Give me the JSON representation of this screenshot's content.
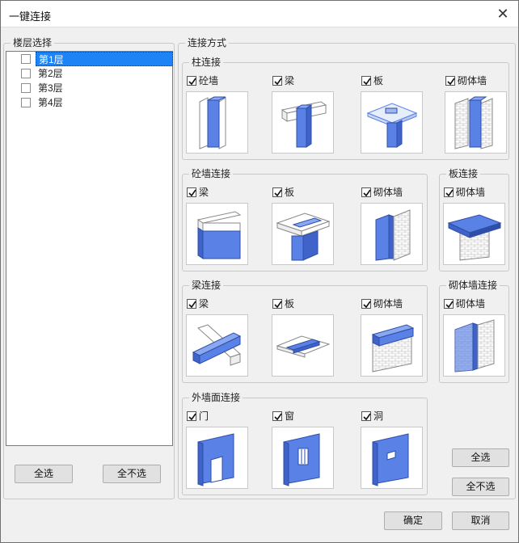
{
  "window": {
    "title": "一键连接",
    "close_glyph": "✕"
  },
  "floor_panel": {
    "label": "楼层选择",
    "floors": [
      {
        "label": "第1层",
        "checked": false,
        "selected": true
      },
      {
        "label": "第2层",
        "checked": false,
        "selected": false
      },
      {
        "label": "第3层",
        "checked": false,
        "selected": false
      },
      {
        "label": "第4层",
        "checked": false,
        "selected": false
      }
    ],
    "select_all_label": "全选",
    "select_none_label": "全不选"
  },
  "connect": {
    "label": "连接方式",
    "column": {
      "label": "柱连接",
      "options": [
        {
          "label": "砼墙",
          "checked": true,
          "icon": "column-concrete-wall-icon"
        },
        {
          "label": "梁",
          "checked": true,
          "icon": "column-beam-icon"
        },
        {
          "label": "板",
          "checked": true,
          "icon": "column-slab-icon"
        },
        {
          "label": "砌体墙",
          "checked": true,
          "icon": "column-masonry-wall-icon"
        }
      ]
    },
    "concrete_wall": {
      "label": "砼墙连接",
      "options": [
        {
          "label": "梁",
          "checked": true,
          "icon": "wall-beam-icon"
        },
        {
          "label": "板",
          "checked": true,
          "icon": "wall-slab-icon"
        },
        {
          "label": "砌体墙",
          "checked": true,
          "icon": "wall-masonry-icon"
        }
      ]
    },
    "slab": {
      "label": "板连接",
      "options": [
        {
          "label": "砌体墙",
          "checked": true,
          "icon": "slab-masonry-icon"
        }
      ]
    },
    "beam": {
      "label": "梁连接",
      "options": [
        {
          "label": "梁",
          "checked": true,
          "icon": "beam-beam-icon"
        },
        {
          "label": "板",
          "checked": true,
          "icon": "beam-slab-icon"
        },
        {
          "label": "砌体墙",
          "checked": true,
          "icon": "beam-masonry-icon"
        }
      ]
    },
    "masonry": {
      "label": "砌体墙连接",
      "options": [
        {
          "label": "砌体墙",
          "checked": true,
          "icon": "masonry-masonry-icon"
        }
      ]
    },
    "exterior": {
      "label": "外墙面连接",
      "options": [
        {
          "label": "门",
          "checked": true,
          "icon": "door-icon"
        },
        {
          "label": "窗",
          "checked": true,
          "icon": "window-icon"
        },
        {
          "label": "洞",
          "checked": true,
          "icon": "opening-icon"
        }
      ]
    },
    "select_all_label": "全选",
    "select_none_label": "全不选"
  },
  "footer": {
    "ok_label": "确定",
    "cancel_label": "取消"
  },
  "colors": {
    "accent_blue": "#5a82e6",
    "selection": "#1e84f5",
    "dialog_bg": "#f0f0f0"
  }
}
